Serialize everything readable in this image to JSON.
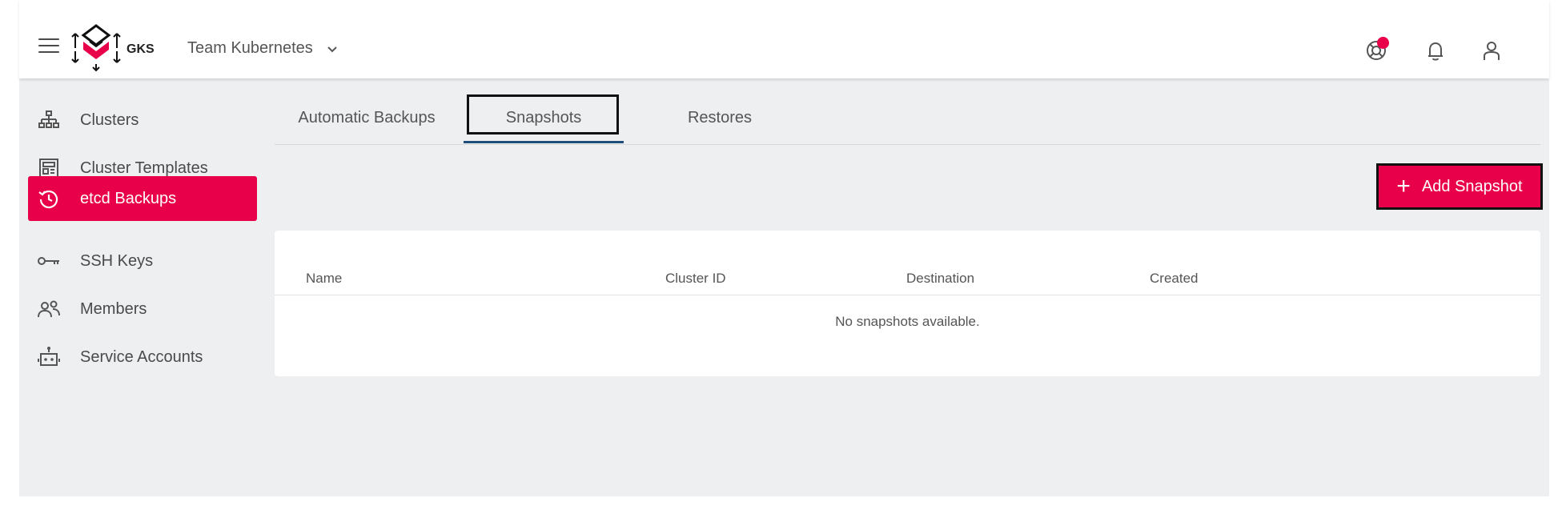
{
  "header": {
    "logo_text": "GKS",
    "project": "Team Kubernetes",
    "icons": [
      "menu-icon",
      "help-icon",
      "bell-icon",
      "user-icon"
    ],
    "notification_color": "#e8004a"
  },
  "sidebar": {
    "items": [
      {
        "label": "Clusters",
        "icon": "sitemap-icon"
      },
      {
        "label": "Cluster Templates",
        "icon": "template-icon"
      },
      {
        "label": "etcd Backups",
        "icon": "history-icon",
        "active": true
      },
      {
        "label": "SSH Keys",
        "icon": "key-icon"
      },
      {
        "label": "Members",
        "icon": "members-icon"
      },
      {
        "label": "Service Accounts",
        "icon": "robot-icon"
      }
    ]
  },
  "tabs": [
    {
      "label": "Automatic Backups"
    },
    {
      "label": "Snapshots",
      "active": true
    },
    {
      "label": "Restores"
    }
  ],
  "actions": {
    "add_snapshot": "Add Snapshot"
  },
  "table": {
    "columns": [
      "Name",
      "Cluster ID",
      "Destination",
      "Created"
    ],
    "empty_message": "No snapshots available."
  },
  "colors": {
    "accent": "#e8004a",
    "tab_underline": "#1d4f7a",
    "background": "#eeeff1"
  }
}
